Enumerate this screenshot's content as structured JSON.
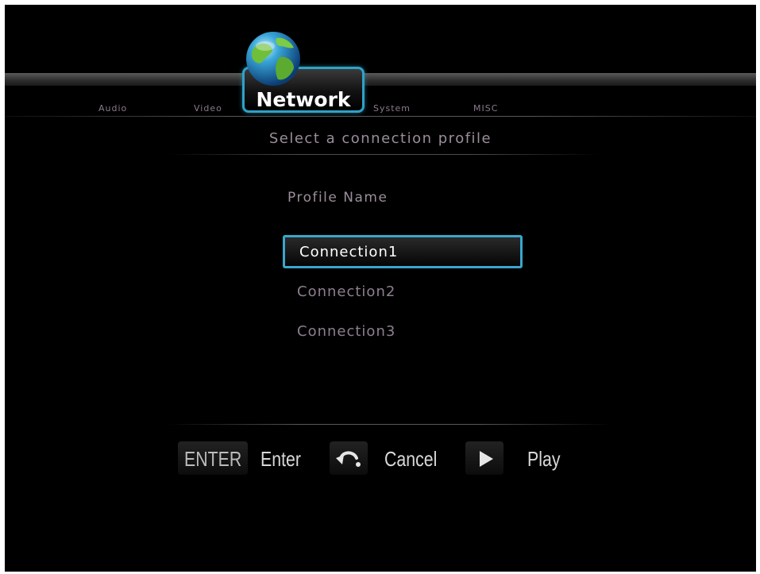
{
  "tabs": {
    "audio": "Audio",
    "video": "Video",
    "network": "Network",
    "system": "System",
    "misc": "MISC"
  },
  "subtitle": "Select a connection profile",
  "profiles": {
    "header": "Profile Name",
    "items": [
      "Connection1",
      "Connection2",
      "Connection3"
    ],
    "selected_index": 0
  },
  "hints": {
    "enter_key": "ENTER",
    "enter_label": "Enter",
    "cancel_label": "Cancel",
    "play_label": "Play"
  },
  "icons": {
    "globe": "globe-icon",
    "cancel": "return-arrow-icon",
    "play": "play-icon"
  },
  "colors": {
    "background": "#000000",
    "accent": "#3aa6cc",
    "dim_text": "#8d7f8e",
    "selected_text": "#ffffff"
  }
}
